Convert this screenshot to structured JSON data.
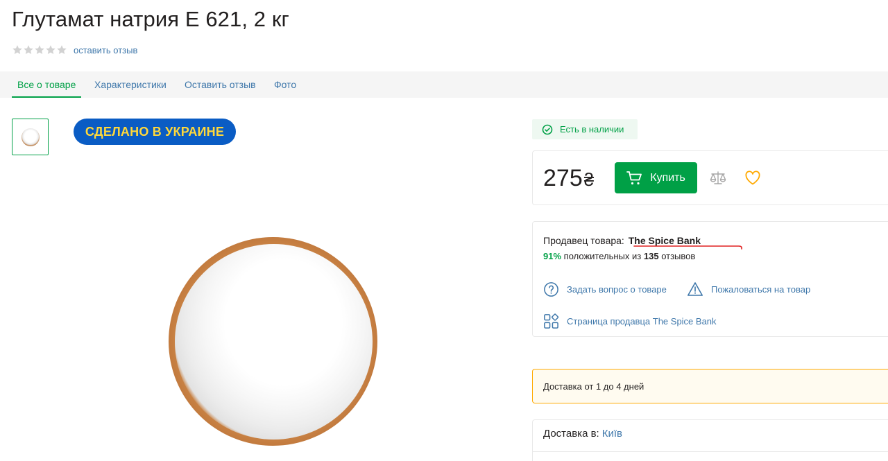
{
  "product": {
    "title": "Глутамат натрия Е 621, 2 кг",
    "review_link": "оставить отзыв",
    "rating": 0,
    "rating_max": 5
  },
  "tabs": [
    {
      "label": "Все о товаре",
      "active": true
    },
    {
      "label": "Характеристики",
      "active": false
    },
    {
      "label": "Оставить отзыв",
      "active": false
    },
    {
      "label": "Фото",
      "active": false
    }
  ],
  "badge": {
    "text": "СДЕЛАНО В УКРАИНЕ"
  },
  "availability": {
    "text": "Есть в наличии",
    "icon": "check-circle-icon"
  },
  "purchase": {
    "price": "275",
    "currency": "₴",
    "buy_label": "Купить"
  },
  "seller": {
    "prefix": "Продавец товара:",
    "name": "The Spice Bank",
    "positive_pct": "91%",
    "positive_text": "положительных из",
    "reviews_count": "135",
    "reviews_word": "отзывов"
  },
  "actions": {
    "ask_question": "Задать вопрос о товаре",
    "complain": "Пожаловаться на товар",
    "seller_page": "Страница продавца The Spice Bank"
  },
  "delivery": {
    "note": "Доставка от 1 до 4 дней",
    "to_label": "Доставка в:",
    "city": "Київ"
  },
  "colors": {
    "accent_green": "#00a046",
    "link_blue": "#3e77aa",
    "badge_blue": "#0a5cc4",
    "badge_yellow": "#ffd83a",
    "favorite_yellow": "#ffa900",
    "warning_border": "#ffa900"
  }
}
